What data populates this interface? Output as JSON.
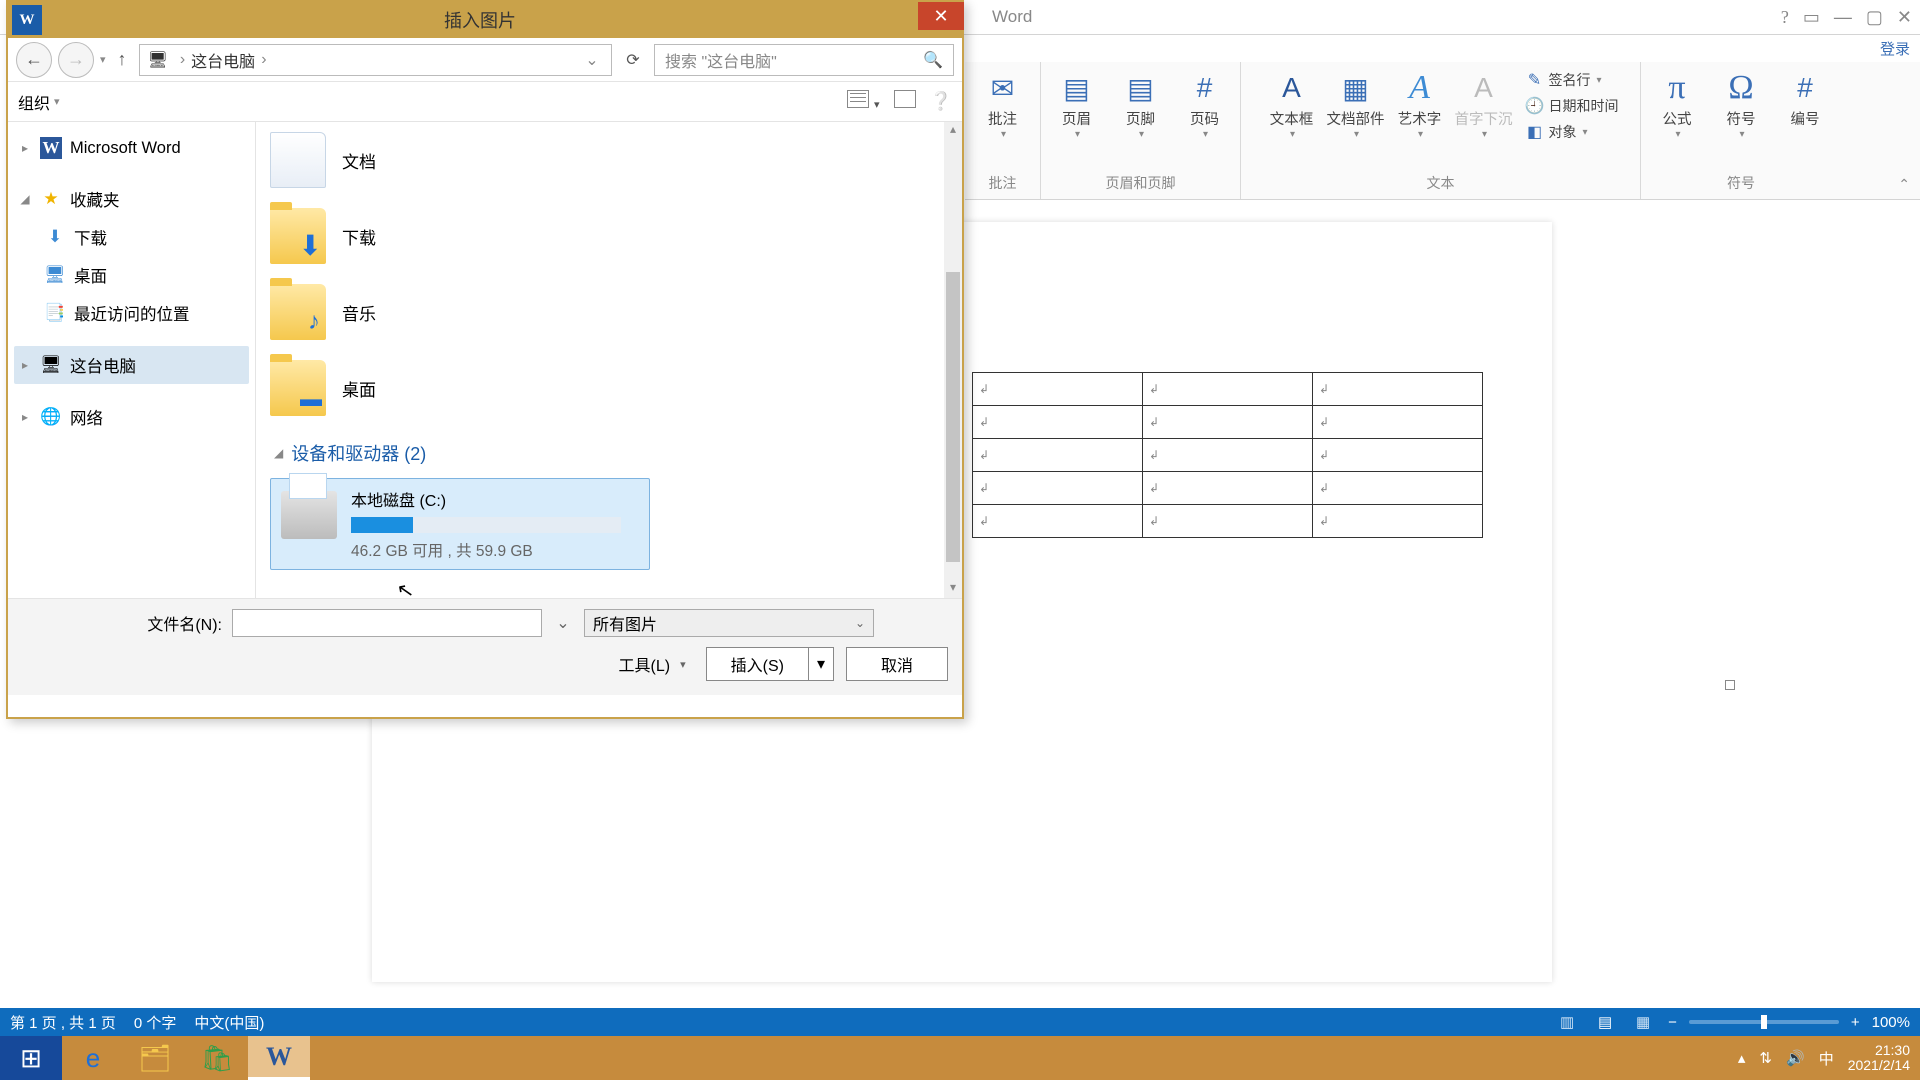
{
  "word": {
    "title": "Word",
    "login": "登录",
    "ribbon": {
      "groups": [
        {
          "label": "批注",
          "items": [
            {
              "name": "批注"
            }
          ]
        },
        {
          "label": "页眉和页脚",
          "items": [
            {
              "name": "页眉"
            },
            {
              "name": "页脚"
            },
            {
              "name": "页码"
            }
          ]
        },
        {
          "label": "文本",
          "items": [
            {
              "name": "文本框"
            },
            {
              "name": "文档部件"
            },
            {
              "name": "艺术字"
            },
            {
              "name": "首字下沉"
            }
          ],
          "side": [
            {
              "name": "签名行"
            },
            {
              "name": "日期和时间"
            },
            {
              "name": "对象"
            }
          ]
        },
        {
          "label": "符号",
          "items": [
            {
              "name": "公式"
            },
            {
              "name": "符号"
            },
            {
              "name": "编号"
            }
          ]
        }
      ]
    }
  },
  "statusbar": {
    "page": "第 1 页 , 共 1 页",
    "words": "0 个字",
    "lang": "中文(中国)",
    "zoom": "100%"
  },
  "dialog": {
    "title": "插入图片",
    "breadcrumb": [
      "这台电脑"
    ],
    "search_placeholder": "搜索 \"这台电脑\"",
    "organize": "组织",
    "tree": [
      {
        "label": "Microsoft Word",
        "icon": "W",
        "caret": "▸"
      },
      {
        "label": "收藏夹",
        "icon": "★",
        "caret": "◢",
        "color": "#f0b400"
      },
      {
        "label": "下载",
        "icon": "⬇",
        "indent": true
      },
      {
        "label": "桌面",
        "icon": "🖥",
        "indent": true
      },
      {
        "label": "最近访问的位置",
        "icon": "📑",
        "indent": true
      },
      {
        "label": "这台电脑",
        "icon": "🖥",
        "caret": "▸",
        "selected": true
      },
      {
        "label": "网络",
        "icon": "🌐",
        "caret": "▸"
      }
    ],
    "folders": [
      {
        "label": "文档",
        "kind": "docs"
      },
      {
        "label": "下载",
        "kind": "download"
      },
      {
        "label": "音乐",
        "kind": "music"
      },
      {
        "label": "桌面",
        "kind": "desktop"
      }
    ],
    "devices_header": "设备和驱动器 (2)",
    "drive": {
      "name": "本地磁盘 (C:)",
      "detail": "46.2 GB 可用 , 共 59.9 GB",
      "used_pct": 23
    },
    "filename_label": "文件名(N):",
    "filetype": "所有图片",
    "tools": "工具(L)",
    "insert": "插入(S)",
    "cancel": "取消"
  },
  "taskbar": {
    "ime": "中",
    "time": "21:30",
    "date": "2021/2/14"
  }
}
